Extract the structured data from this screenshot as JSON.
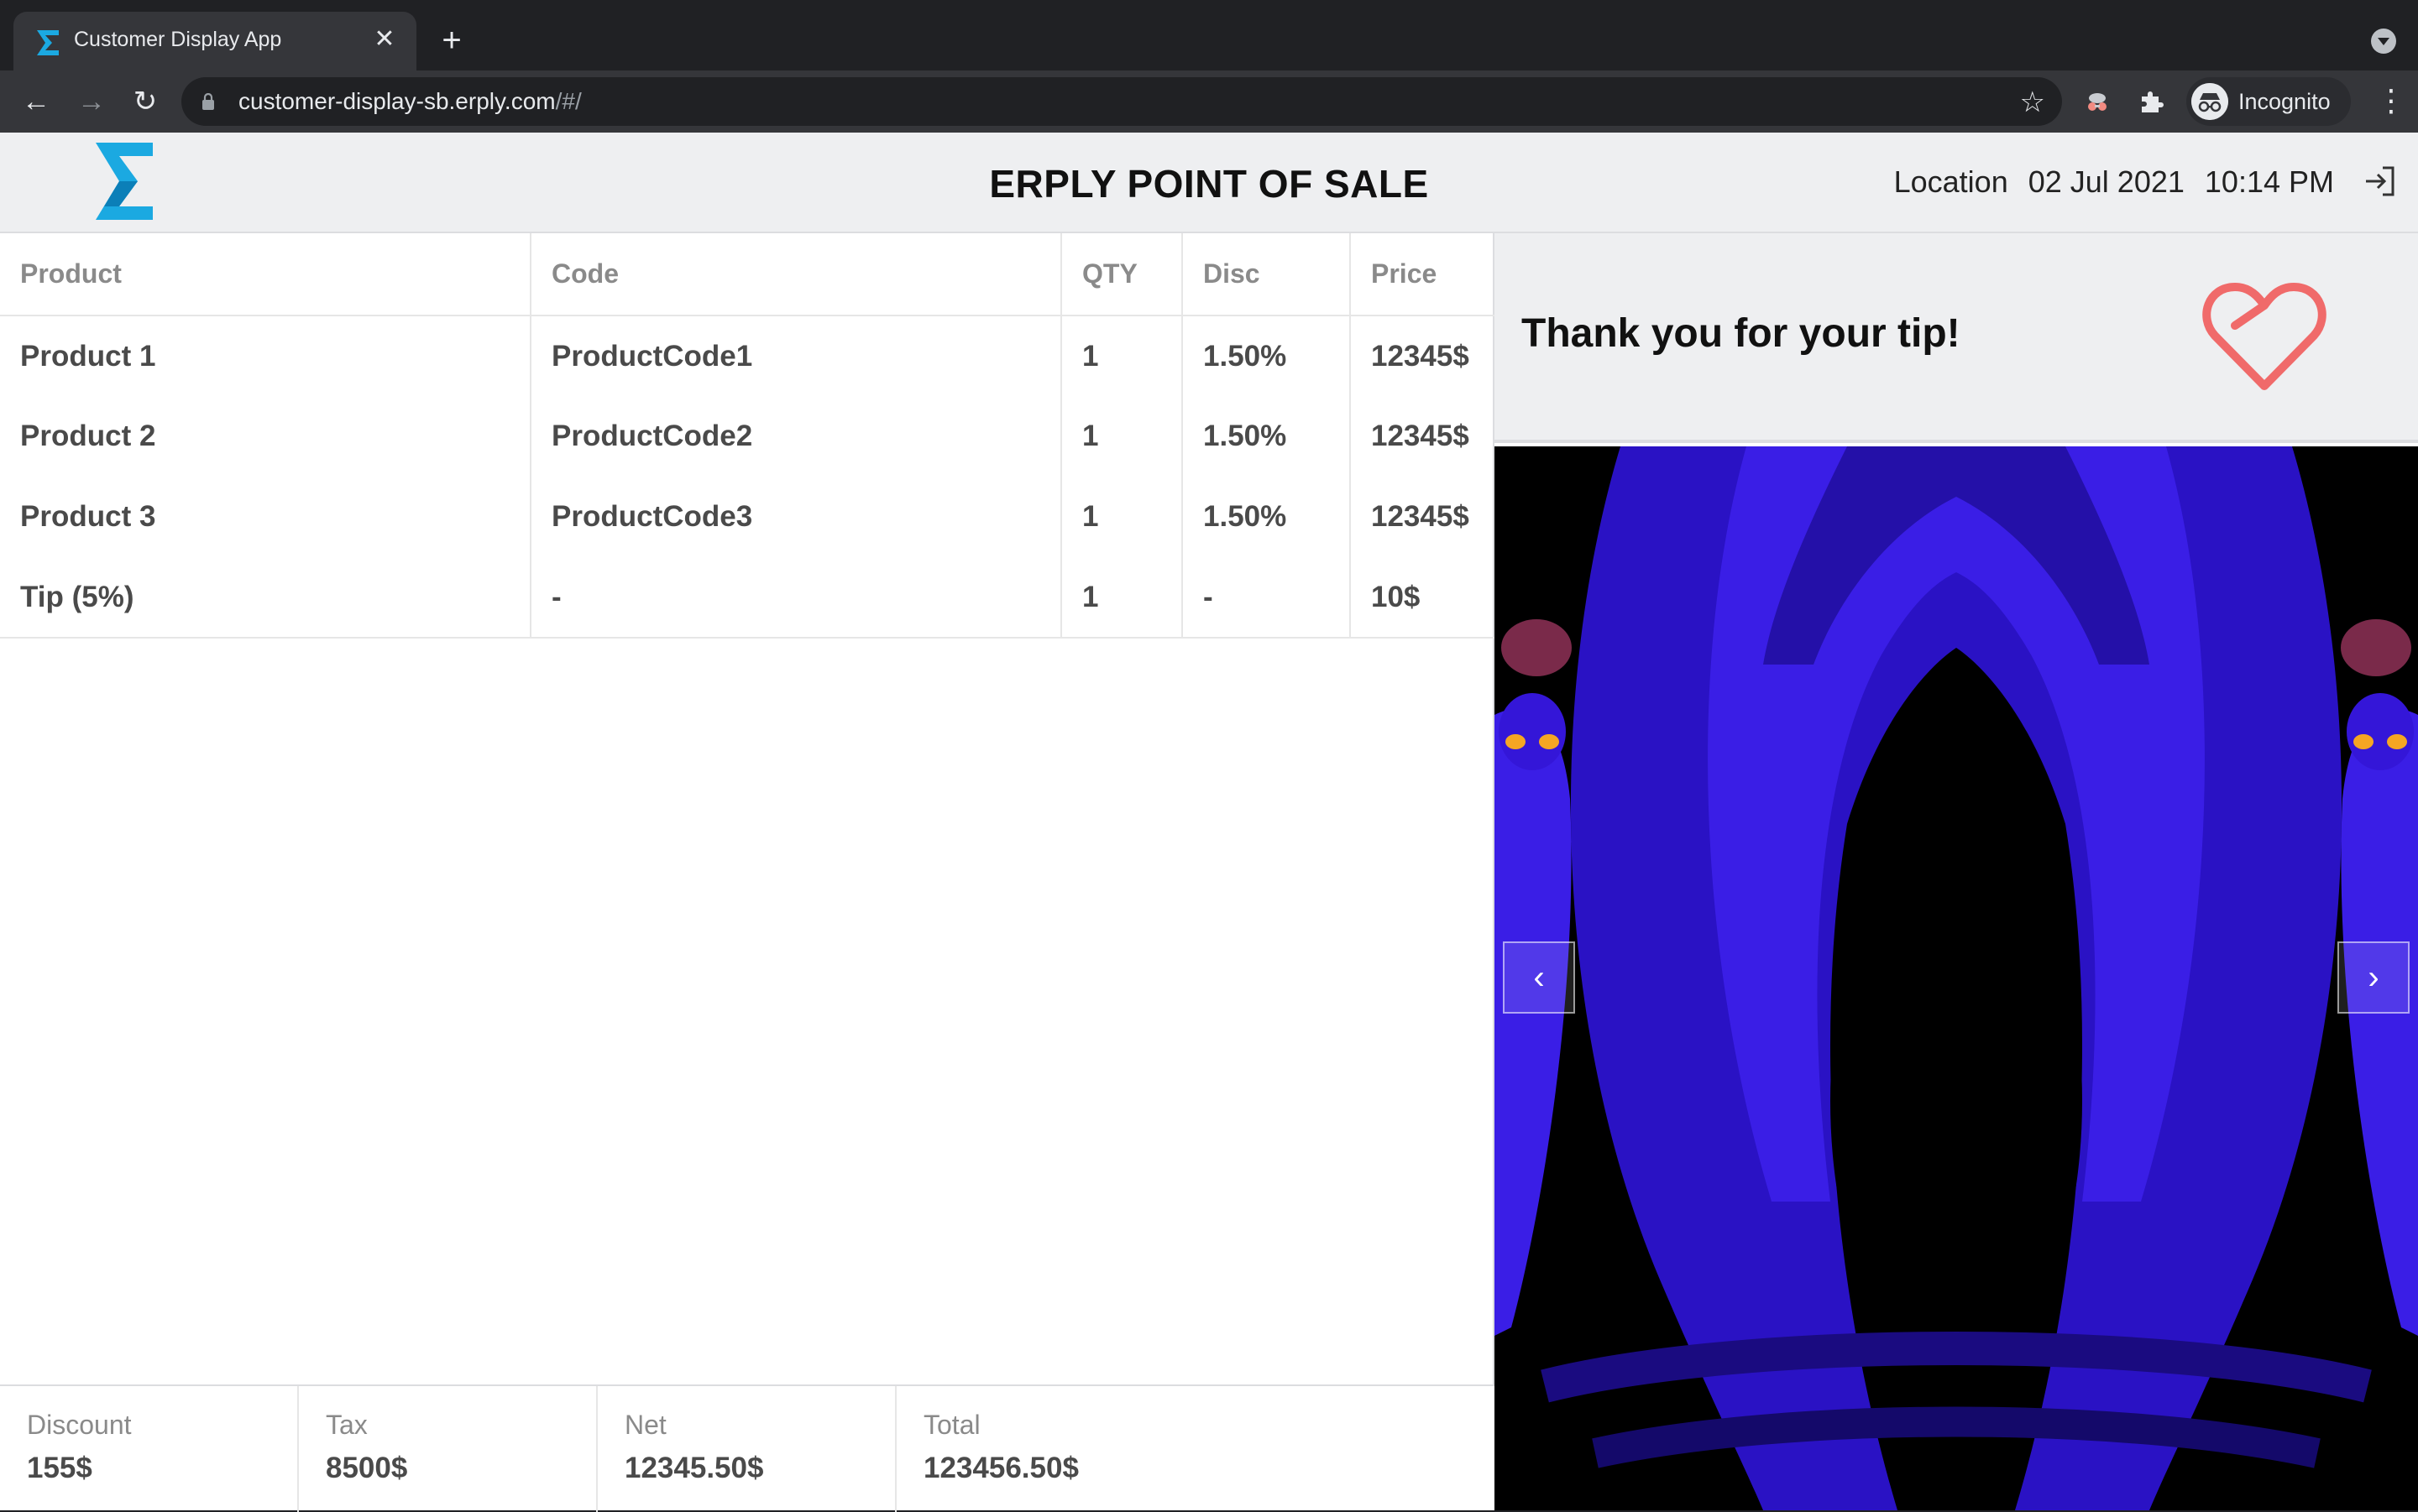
{
  "browser": {
    "tab_title": "Customer Display App",
    "tab_close": "✕",
    "new_tab": "+",
    "url_host": "customer-display-sb.erply.com",
    "url_path": "/#/",
    "profile_label": "Incognito"
  },
  "header": {
    "title": "ERPLY POINT OF SALE",
    "location": "Location",
    "date": "02 Jul 2021",
    "time": "10:14 PM"
  },
  "table": {
    "columns": [
      "Product",
      "Code",
      "QTY",
      "Disc",
      "Price"
    ],
    "rows": [
      [
        "Product 1",
        "ProductCode1",
        "1",
        "1.50%",
        "12345$"
      ],
      [
        "Product 2",
        "ProductCode2",
        "1",
        "1.50%",
        "12345$"
      ],
      [
        "Product 3",
        "ProductCode3",
        "1",
        "1.50%",
        "12345$"
      ],
      [
        "Tip (5%)",
        "-",
        "1",
        "-",
        "10$"
      ]
    ]
  },
  "totals": [
    {
      "label": "Discount",
      "value": "155$"
    },
    {
      "label": "Tax",
      "value": "8500$"
    },
    {
      "label": "Net",
      "value": "12345.50$"
    },
    {
      "label": "Total",
      "value": "123456.50$"
    }
  ],
  "tip_message": "Thank you for your tip!",
  "carousel": {
    "prev": "‹",
    "next": "›"
  },
  "colors": {
    "brand_blue": "#1ba9e1",
    "heart": "#f06a6a",
    "media_blue": "#2f14d8"
  }
}
